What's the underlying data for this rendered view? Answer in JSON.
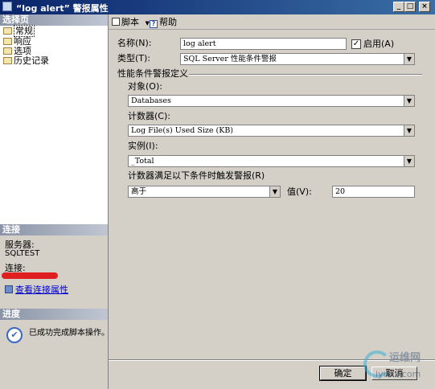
{
  "window": {
    "title": "“log alert” 警报属性",
    "min_symbol": "_",
    "max_symbol": "□",
    "close_symbol": "×"
  },
  "left_panel": {
    "select_page_header": "选择页",
    "pages": [
      "常规",
      "响应",
      "选项",
      "历史记录"
    ],
    "connection_header": "连接",
    "server_label": "服务器:",
    "server_value": "SQLTEST",
    "connection_label": "连接:",
    "view_connection_link": "查看连接属性",
    "progress_header": "进度",
    "progress_status": "已成功完成脚本操作。"
  },
  "toolbar": {
    "script_label": "脚本",
    "help_label": "帮助"
  },
  "form": {
    "name_label": "名称(N):",
    "name_value": "log alert",
    "enabled_label": "启用(A)",
    "enabled_checked": true,
    "type_label": "类型(T):",
    "type_value": "SQL Server 性能条件警报",
    "definition_header": "性能条件警报定义",
    "object_label": "对象(O):",
    "object_value": "Databases",
    "counter_label": "计数器(C):",
    "counter_value": "Log File(s) Used Size (KB)",
    "instance_label": "实例(I):",
    "instance_value": "_Total",
    "condition_label": "计数器满足以下条件时触发警报(R)",
    "condition_value": "高于",
    "value_label": "值(V):",
    "value_value": "20"
  },
  "buttons": {
    "ok": "确定",
    "cancel": "取消"
  },
  "watermark": {
    "text": "运维网",
    "url": "iyunv.com"
  }
}
